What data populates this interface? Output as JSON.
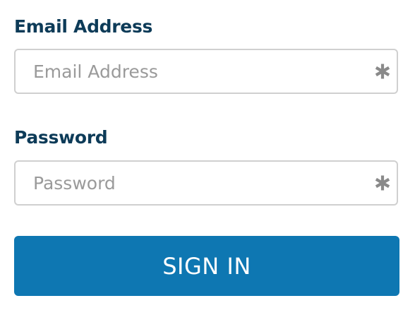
{
  "form": {
    "email": {
      "label": "Email Address",
      "placeholder": "Email Address",
      "value": "",
      "required_icon": "asterisk-icon"
    },
    "password": {
      "label": "Password",
      "placeholder": "Password",
      "value": "",
      "required_icon": "asterisk-icon"
    },
    "submit_label": "SIGN IN"
  },
  "colors": {
    "label_text": "#0d3b58",
    "input_border": "#d0d0d0",
    "placeholder_text": "#9a9a9a",
    "required_icon": "#8a8a8a",
    "button_background": "#0e77b2",
    "button_text": "#ffffff"
  }
}
